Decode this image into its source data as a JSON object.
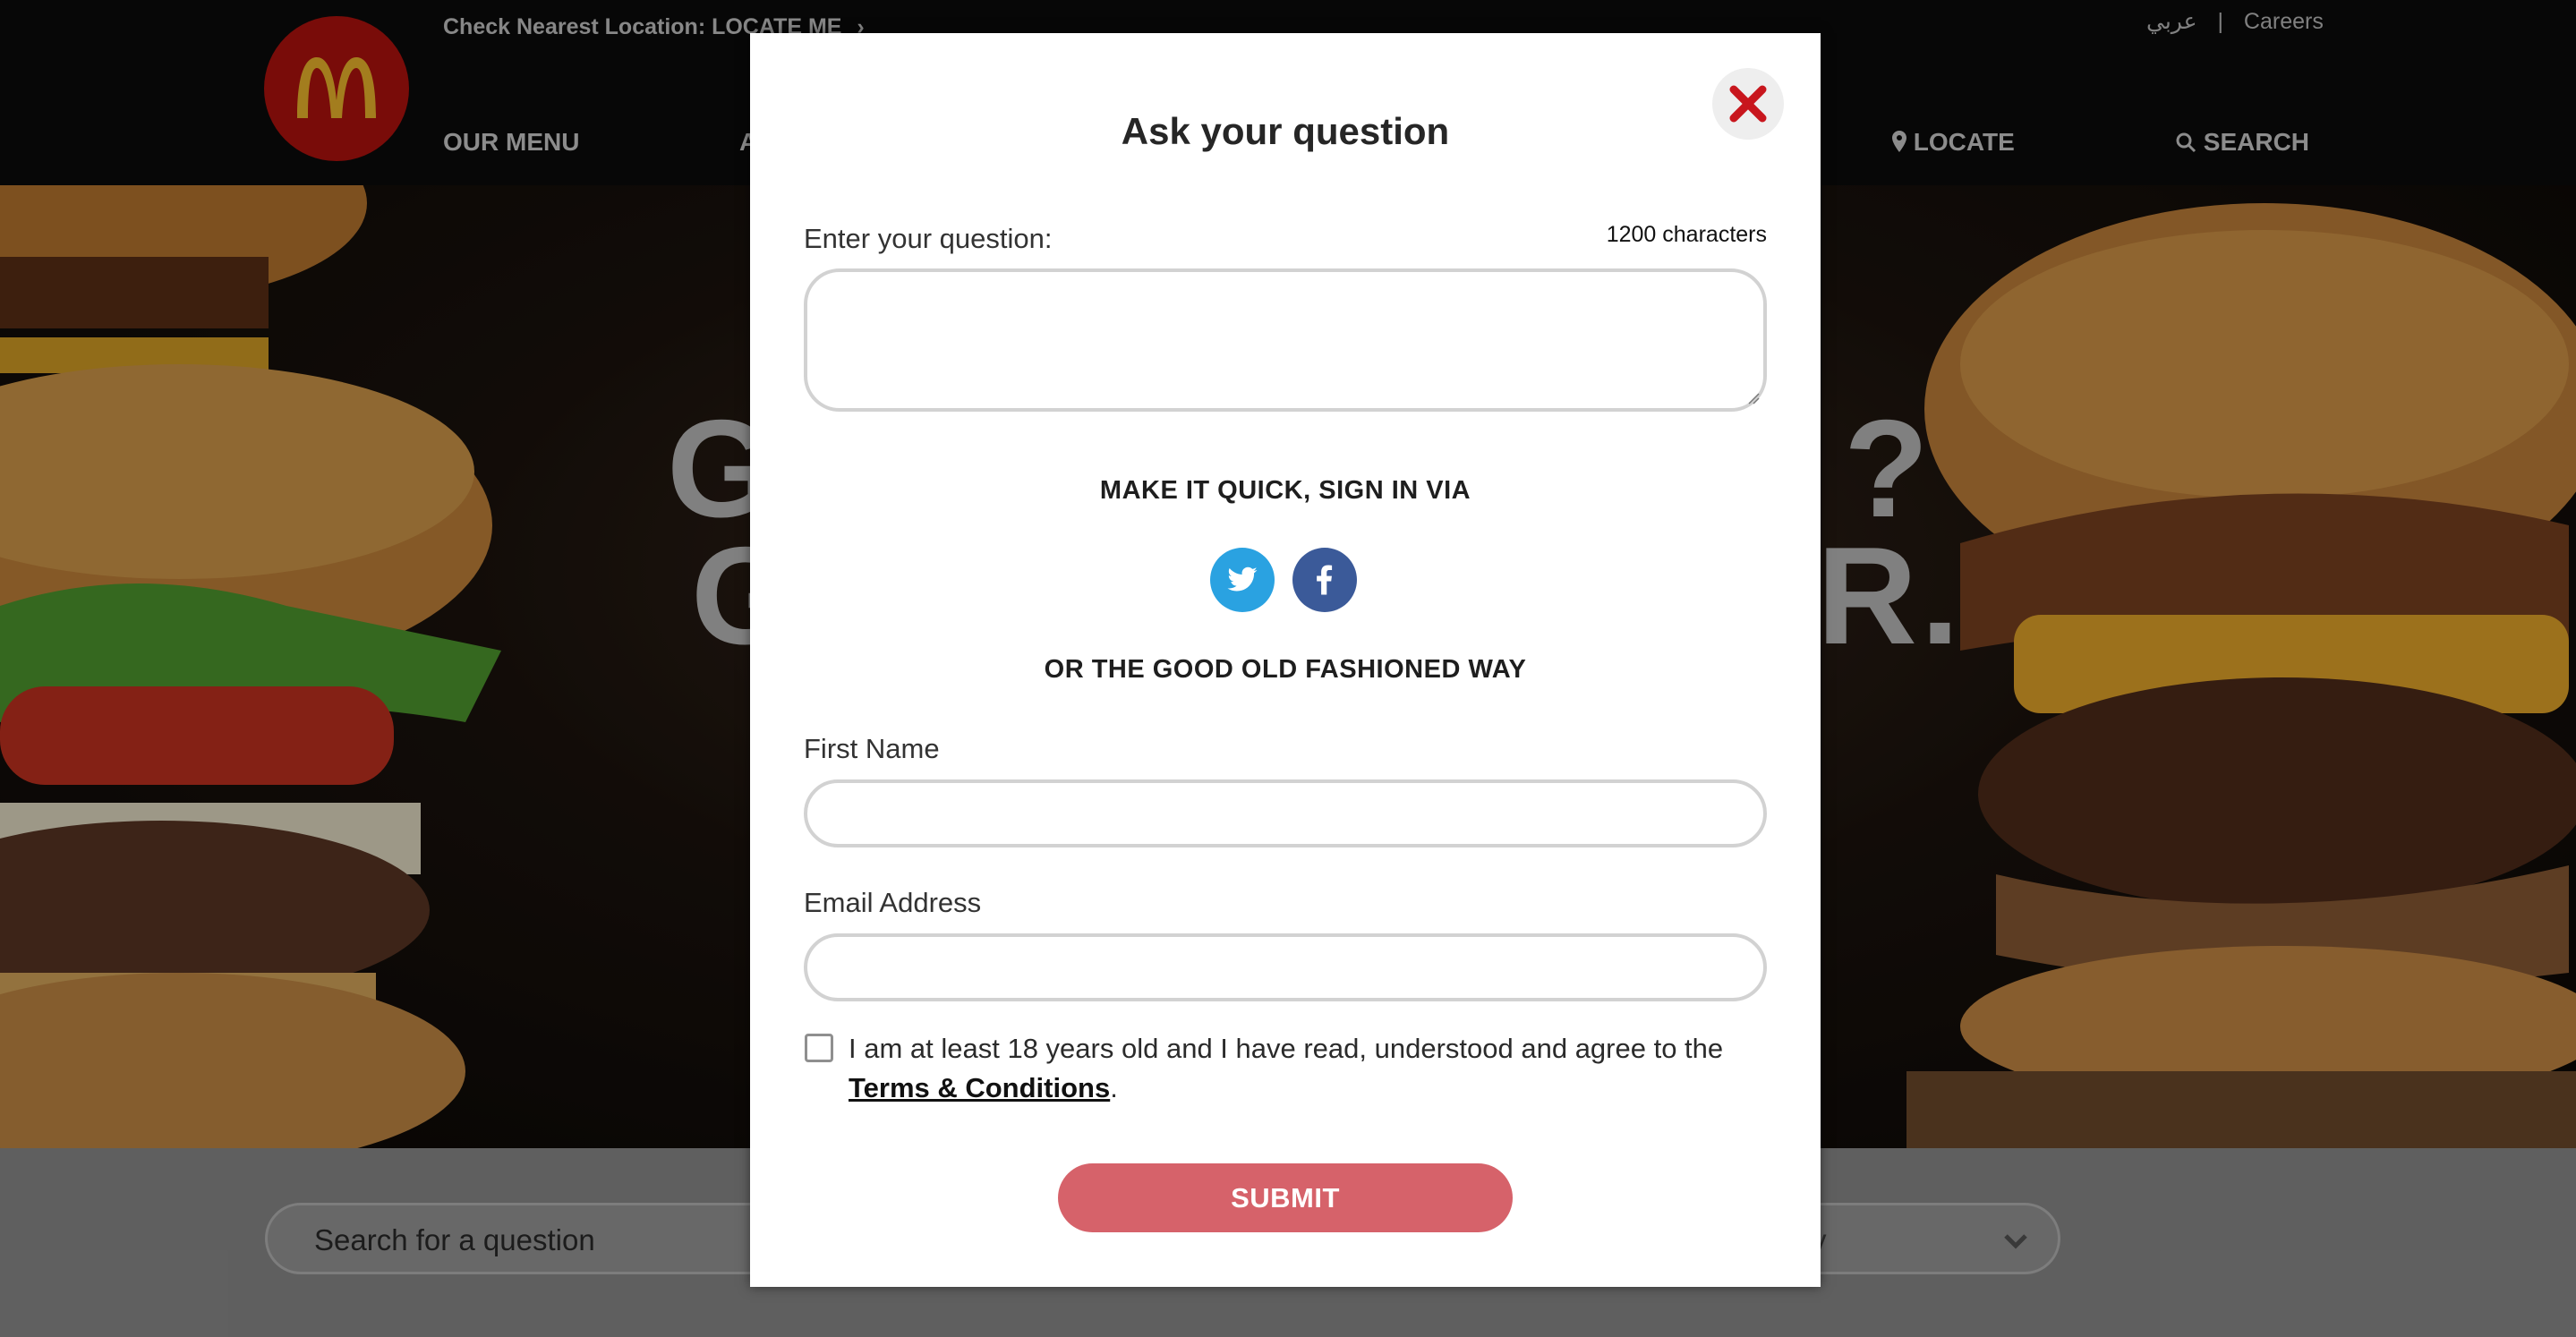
{
  "header": {
    "locate_prefix": "Check Nearest Location:",
    "locate_link": "LOCATE ME",
    "arabic_link": "عربي",
    "separator": "|",
    "careers_link": "Careers",
    "nav": {
      "our_menu": "OUR MENU",
      "partial": "A",
      "locate": "LOCATE",
      "search": "SEARCH"
    }
  },
  "hero": {
    "left_line1": "G",
    "left_line2": "G",
    "right_line1": "?",
    "right_line2": "R."
  },
  "search_strip": {
    "placeholder": "Search for a question",
    "dropdown_partial": "y"
  },
  "modal": {
    "title": "Ask your question",
    "question_label": "Enter your question:",
    "char_count": "1200 characters",
    "question_value": "",
    "social_heading": "MAKE IT QUICK, SIGN IN VIA",
    "social": [
      "twitter-icon",
      "facebook-icon"
    ],
    "manual_heading": "OR THE GOOD OLD FASHIONED WAY",
    "first_name_label": "First Name",
    "first_name_value": "",
    "email_label": "Email Address",
    "email_value": "",
    "agree_text": "I am at least 18 years old and I have read, understood and agree to the",
    "terms_link": "Terms & Conditions",
    "agree_period": ".",
    "agree_checked": false,
    "submit_label": "SUBMIT"
  },
  "colors": {
    "brand_red": "#b3120e",
    "logo_yellow": "#f1b82d",
    "submit": "#d6626a",
    "twitter": "#2aa2e1",
    "facebook": "#3b5a99",
    "close_x": "#c8161d"
  }
}
